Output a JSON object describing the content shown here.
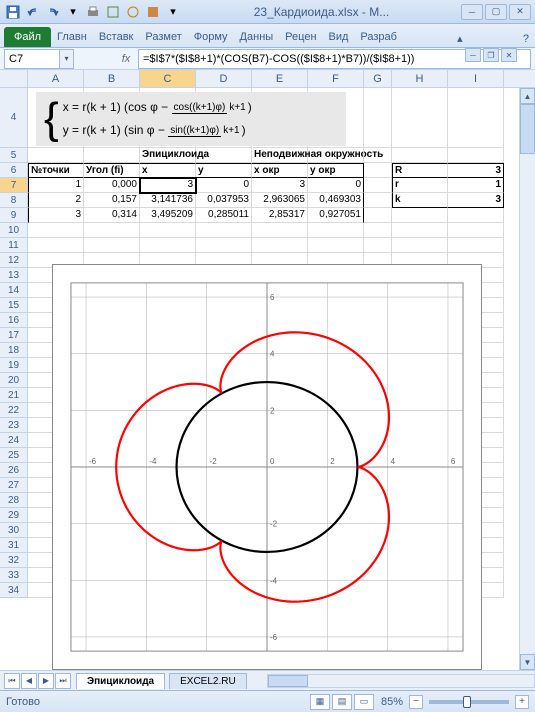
{
  "window": {
    "title": "23_Кардиоида.xlsx - M..."
  },
  "ribbon": {
    "file": "Файл",
    "tabs": [
      "Главн",
      "Вставк",
      "Размет",
      "Форму",
      "Данны",
      "Рецен",
      "Вид",
      "Разраб"
    ]
  },
  "formula_bar": {
    "name_box": "C7",
    "fx": "fx",
    "formula": "=$I$7*($I$8+1)*(COS(B7)-COS(($I$8+1)*B7))/($I$8+1))"
  },
  "columns": [
    "A",
    "B",
    "C",
    "D",
    "E",
    "F",
    "G",
    "H",
    "I"
  ],
  "row_start": 4,
  "row_end": 34,
  "headers_row5": {
    "CD": "Эпициклоида",
    "EF": "Неподвижная окружность"
  },
  "headers_row6": {
    "A": "№точки",
    "B": "Угол (fi)",
    "C": "x",
    "D": "y",
    "E": "x окр",
    "F": "y окр",
    "H": "R",
    "I": "3"
  },
  "data_rows": [
    {
      "n": "1",
      "fi": "0,000",
      "x": "3",
      "y": "0",
      "xo": "3",
      "yo": "0",
      "pl": "r",
      "pv": "1",
      "sel": true
    },
    {
      "n": "2",
      "fi": "0,157",
      "x": "3,141736",
      "y": "0,037953",
      "xo": "2,963065",
      "yo": "0,469303",
      "pl": "k",
      "pv": "3"
    },
    {
      "n": "3",
      "fi": "0,314",
      "x": "3,495209",
      "y": "0,285011",
      "xo": "2,85317",
      "yo": "0,927051"
    }
  ],
  "formula_image": {
    "line1_lhs": "x = r(k + 1)",
    "line1_paren_a": "cos φ −",
    "line1_frac_num": "cos((k+1)φ)",
    "line1_frac_den": "k+1",
    "line2_lhs": "y = r(k + 1)",
    "line2_paren_a": "sin φ −",
    "line2_frac_num": "sin((k+1)φ)",
    "line2_frac_den": "k+1"
  },
  "sheets": {
    "active": "Эпициклоида",
    "other": "EXCEL2.RU"
  },
  "status": {
    "ready": "Готово",
    "zoom": "85%"
  },
  "chart_data": {
    "type": "line",
    "title": "",
    "xlim": [
      -6.5,
      6.5
    ],
    "ylim": [
      -6.5,
      6.5
    ],
    "x_ticks": [
      -6,
      -4,
      -2,
      0,
      2,
      4,
      6
    ],
    "y_ticks": [
      -6,
      -4,
      -2,
      0,
      2,
      4,
      6
    ],
    "series": [
      {
        "name": "Неподвижная окружность",
        "kind": "circle",
        "cx": 0,
        "cy": 0,
        "r": 3,
        "color": "#000000"
      },
      {
        "name": "Эпициклоида",
        "kind": "parametric",
        "R": 3,
        "r": 1,
        "k": 3,
        "color": "#ff0000",
        "note": "x=r(k+1)(cos t - cos((k+1)t)/(k+1)); y=r(k+1)(sin t - sin((k+1)t)/(k+1)); t∈[0,2π]; r=1,k=3 ⇒ outer reach 5, cusps at r=3 (3 lobes)"
      }
    ]
  }
}
